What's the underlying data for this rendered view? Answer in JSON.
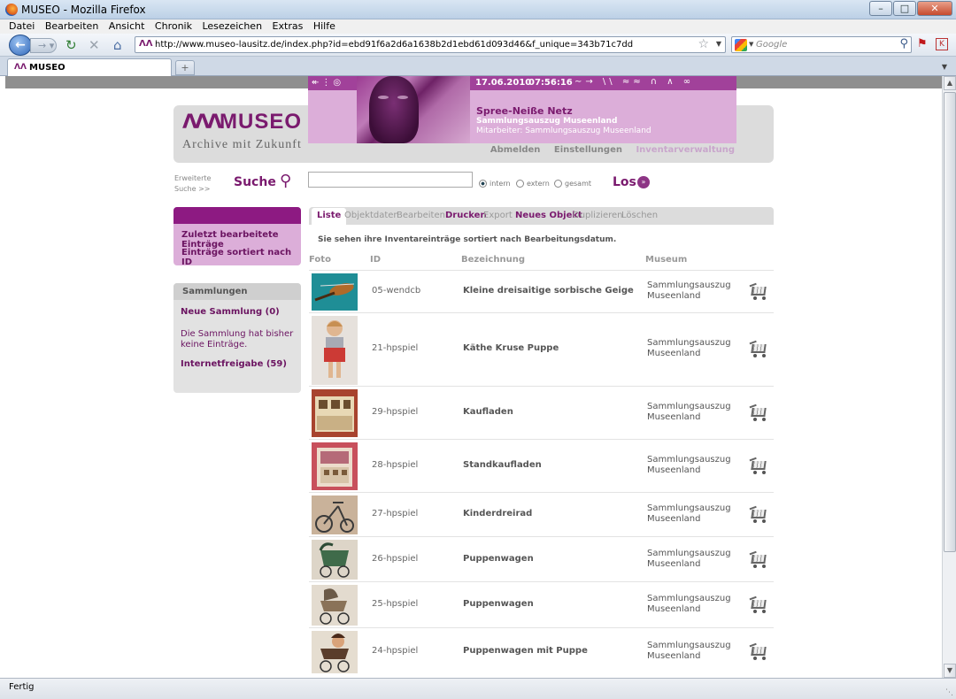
{
  "window": {
    "title": "MUSEO - Mozilla Firefox",
    "minimize": "–",
    "maximize": "□",
    "close": "✕"
  },
  "menu": [
    "Datei",
    "Bearbeiten",
    "Ansicht",
    "Chronik",
    "Lesezeichen",
    "Extras",
    "Hilfe"
  ],
  "browser": {
    "url": "http://www.museo-lausitz.de/index.php?id=ebd91f6a2d6a1638b2d1ebd61d093d46&f_unique=343b71c7dd",
    "search_placeholder": "Google",
    "tab_label": "MUSEO",
    "status": "Fertig"
  },
  "icons": {
    "back": "back-arrow-icon",
    "forward": "forward-arrow-icon",
    "reload": "reload-icon",
    "stop": "stop-icon",
    "home": "home-icon",
    "bookmark": "star-icon",
    "search": "magnifier-icon",
    "cart": "shopping-basket-icon"
  },
  "site": {
    "logo_text": "MUSEO",
    "logo_sub": "Archive mit Zukunft",
    "banner": {
      "date": "17.06.2010",
      "time": "07:56:16",
      "org": "Spree-Neiße Netz",
      "collection": "Sammlungsauszug Museenland",
      "worker": "Mitarbeiter: Sammlungsauszug Museenland"
    },
    "header_links": [
      "Abmelden",
      "Einstellungen",
      "Inventarverwaltung"
    ]
  },
  "search": {
    "hint_line1": "Erweiterte",
    "hint_line2": "Suche >>",
    "title": "Suche",
    "value": "",
    "options": [
      "intern",
      "extern",
      "gesamt"
    ],
    "selected": "intern",
    "go_label": "Los"
  },
  "sidebar": {
    "recent": [
      "Zuletzt bearbeitete Einträge",
      "Einträge sortiert nach ID"
    ],
    "collections_title": "Sammlungen",
    "new_collection": "Neue Sammlung (0)",
    "empty_note": "Die Sammlung hat bisher keine Einträge.",
    "internet_release": "Internetfreigabe (59)"
  },
  "tabs": [
    "Liste",
    "Objektdaten",
    "Bearbeiten",
    "Drucken",
    "Export",
    "Neues Objekt",
    "Duplizieren",
    "Löschen"
  ],
  "content": {
    "info": "Sie sehen ihre Inventareinträge sortiert nach Bearbeitungsdatum.",
    "columns": [
      "Foto",
      "ID",
      "Bezeichnung",
      "Museum"
    ],
    "rows": [
      {
        "id": "05-wendcb",
        "name": "Kleine dreisaitige sorbische Geige",
        "museum_line1": "Sammlungsauszug",
        "museum_line2": "Museenland"
      },
      {
        "id": "21-hpspiel",
        "name": "Käthe Kruse Puppe",
        "museum_line1": "Sammlungsauszug",
        "museum_line2": "Museenland"
      },
      {
        "id": "29-hpspiel",
        "name": "Kaufladen",
        "museum_line1": "Sammlungsauszug",
        "museum_line2": "Museenland"
      },
      {
        "id": "28-hpspiel",
        "name": "Standkaufladen",
        "museum_line1": "Sammlungsauszug",
        "museum_line2": "Museenland"
      },
      {
        "id": "27-hpspiel",
        "name": "Kinderdreirad",
        "museum_line1": "Sammlungsauszug",
        "museum_line2": "Museenland"
      },
      {
        "id": "26-hpspiel",
        "name": "Puppenwagen",
        "museum_line1": "Sammlungsauszug",
        "museum_line2": "Museenland"
      },
      {
        "id": "25-hpspiel",
        "name": "Puppenwagen",
        "museum_line1": "Sammlungsauszug",
        "museum_line2": "Museenland"
      },
      {
        "id": "24-hpspiel",
        "name": "Puppenwagen mit Puppe",
        "museum_line1": "Sammlungsauszug",
        "museum_line2": "Museenland"
      }
    ]
  }
}
